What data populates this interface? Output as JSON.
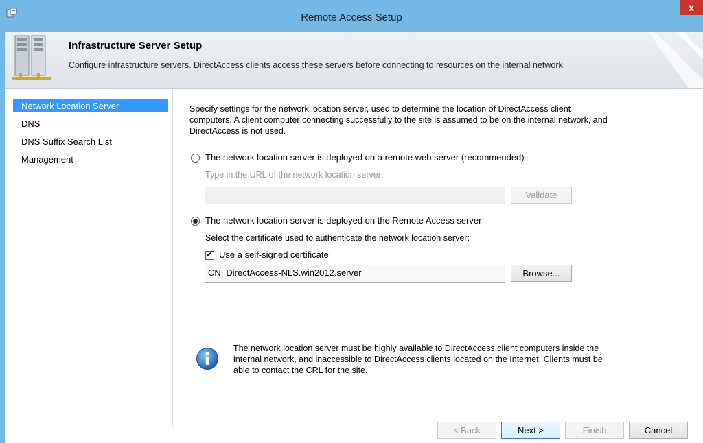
{
  "window": {
    "title": "Remote Access Setup",
    "close_label": "x",
    "accent_color": "#74b8e6"
  },
  "banner": {
    "heading": "Infrastructure Server Setup",
    "description": "Configure infrastructure servers. DirectAccess clients access these servers before connecting to resources on the internal network."
  },
  "nav": {
    "items": [
      {
        "label": "Network Location Server",
        "selected": true
      },
      {
        "label": "DNS",
        "selected": false
      },
      {
        "label": "DNS Suffix Search List",
        "selected": false
      },
      {
        "label": "Management",
        "selected": false
      }
    ]
  },
  "content": {
    "intro": "Specify settings for the network location server, used to determine the location of DirectAccess client computers. A client computer connecting successfully to the site is assumed to be on the internal network, and DirectAccess is not used.",
    "option_remote": {
      "label": "The network location server is deployed on a remote web server (recommended)",
      "selected": false,
      "url_prompt": "Type in the URL of the network location server:",
      "url_value": "",
      "validate_label": "Validate"
    },
    "option_local": {
      "label": "The network location server is deployed on the Remote Access server",
      "selected": true,
      "cert_prompt": "Select the certificate used to authenticate the network location server:",
      "self_signed_label": "Use a self-signed certificate",
      "self_signed_checked": true,
      "cert_value": "CN=DirectAccess-NLS.win2012.server",
      "browse_label": "Browse..."
    },
    "info": "The network location server must be highly available to DirectAccess client computers inside the internal network, and inaccessible to DirectAccess clients located on the Internet. Clients must be able to contact the CRL for the site."
  },
  "buttons": {
    "back": "< Back",
    "next": "Next >",
    "finish": "Finish",
    "cancel": "Cancel"
  }
}
